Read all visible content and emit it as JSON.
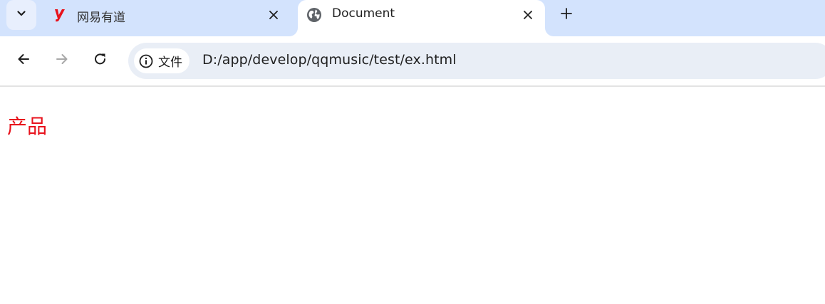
{
  "tabs": [
    {
      "title": "网易有道",
      "favicon": "youdao-y-icon",
      "favicon_color": "#e8121c",
      "active": false
    },
    {
      "title": "Document",
      "favicon": "globe-icon",
      "active": true
    }
  ],
  "omnibox": {
    "security_label": "文件",
    "url": "D:/app/develop/qqmusic/test/ex.html"
  },
  "icons": {
    "tab_search": "chevron-down-icon",
    "tab_close": "close-icon",
    "new_tab": "plus-icon",
    "back": "arrow-left-icon",
    "forward": "arrow-right-icon",
    "reload": "reload-icon",
    "security": "info-circle-icon"
  },
  "page": {
    "heading": "产品",
    "heading_color": "#e8121c"
  },
  "colors": {
    "tabstrip": "#d3e3fd",
    "omnibox": "#e9eef6",
    "forward_disabled": "#a8a8a8"
  }
}
